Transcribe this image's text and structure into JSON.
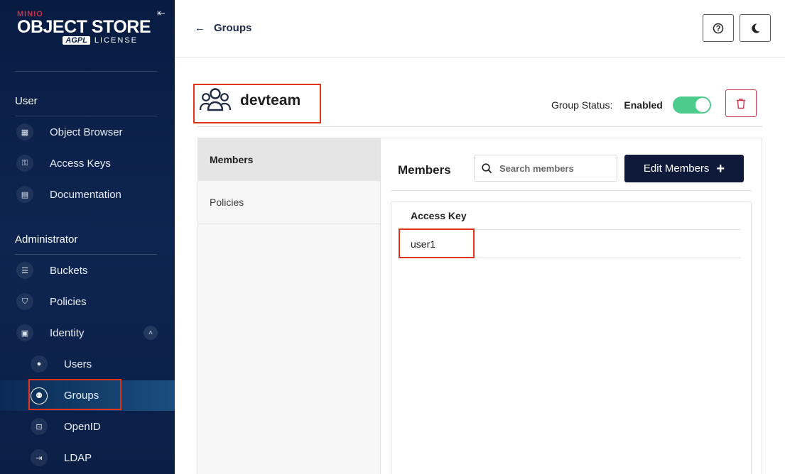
{
  "sidebar": {
    "brand": "MINIO",
    "product": "OBJECT STORE",
    "license_badge": "AGPL",
    "license": "LICENSE",
    "user_section": "User",
    "user_items": [
      {
        "label": "Object Browser",
        "icon": "object-browser-icon"
      },
      {
        "label": "Access Keys",
        "icon": "access-keys-icon"
      },
      {
        "label": "Documentation",
        "icon": "documentation-icon"
      }
    ],
    "admin_section": "Administrator",
    "admin_items": [
      {
        "label": "Buckets",
        "icon": "buckets-icon"
      },
      {
        "label": "Policies",
        "icon": "policies-icon"
      },
      {
        "label": "Identity",
        "icon": "identity-icon"
      }
    ],
    "identity_items": [
      {
        "label": "Users",
        "icon": "user-icon"
      },
      {
        "label": "Groups",
        "icon": "groups-icon"
      },
      {
        "label": "OpenID",
        "icon": "openid-icon"
      },
      {
        "label": "LDAP",
        "icon": "ldap-icon"
      }
    ]
  },
  "header": {
    "back_label": "Groups"
  },
  "group": {
    "name": "devteam",
    "status_label": "Group Status:",
    "status_value": "Enabled",
    "enabled": true
  },
  "tabs": [
    {
      "label": "Members",
      "active": true
    },
    {
      "label": "Policies",
      "active": false
    }
  ],
  "members": {
    "title": "Members",
    "search_placeholder": "Search members",
    "edit_label": "Edit Members",
    "column": "Access Key",
    "rows": [
      "user1"
    ]
  },
  "colors": {
    "sidebar_bg": "#081c42",
    "accent_red": "#e3331c",
    "toggle_on": "#4ccb8d",
    "primary_button": "#0f1a3a"
  }
}
